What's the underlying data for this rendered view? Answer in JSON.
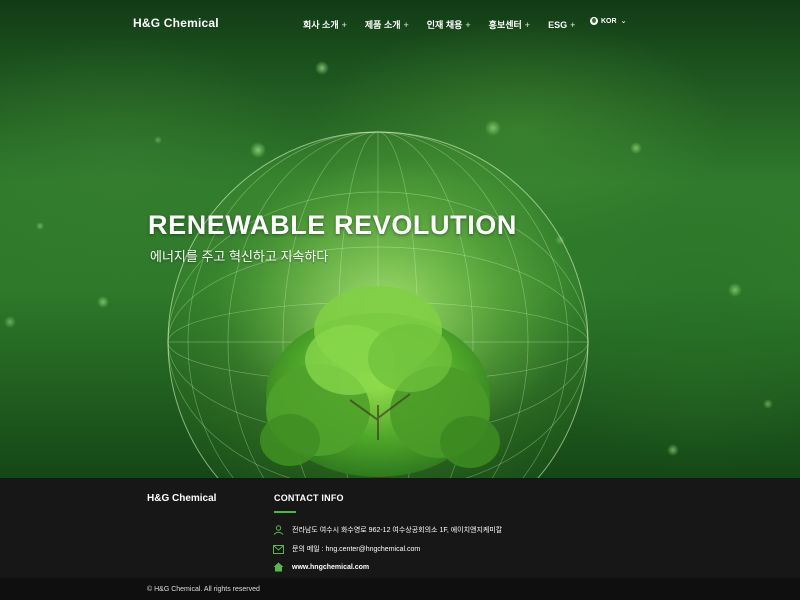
{
  "brand": "H&G Chemical",
  "nav": {
    "items": [
      {
        "label": "회사 소개"
      },
      {
        "label": "제품 소개"
      },
      {
        "label": "인재 채용"
      },
      {
        "label": "홍보센터"
      },
      {
        "label": "ESG"
      }
    ],
    "plus": "+",
    "language": "KOR"
  },
  "hero": {
    "headline": "RENEWABLE REVOLUTION",
    "subhead": "에너지를 주고 혁신하고 지속하다"
  },
  "footer": {
    "brand": "H&G Chemical",
    "contact_title": "CONTACT INFO",
    "address": "전라남도 여수시 화수영로 962-12 여수상공회의소 1F, 에이치앤지케미칼",
    "email": "문의 메일 : hng.center@hngchemical.com",
    "website": "www.hngchemical.com",
    "copyright": "© H&G Chemical. All rights reserved"
  },
  "colors": {
    "accent": "#3fbf3f",
    "footer_bg": "#171717",
    "hero_green": "#2f7a2c"
  },
  "icons": {
    "address": "person-pin-icon",
    "email": "envelope-icon",
    "website": "home-icon",
    "language": "globe-icon"
  }
}
